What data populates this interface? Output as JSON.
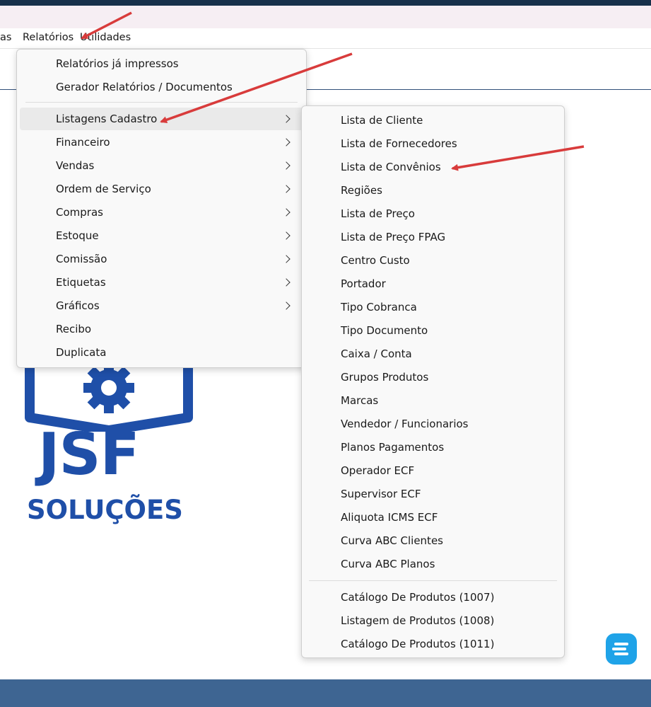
{
  "menubar": {
    "items": [
      {
        "label": "as"
      },
      {
        "label": "Relatórios"
      },
      {
        "label": "Utilidades"
      }
    ]
  },
  "relatorios_menu": {
    "top_items": [
      {
        "label": "Relatórios já impressos"
      },
      {
        "label": "Gerador Relatórios / Documentos"
      }
    ],
    "items": [
      {
        "label": "Listagens Cadastro",
        "submenu": true,
        "highlighted": true
      },
      {
        "label": "Financeiro",
        "submenu": true
      },
      {
        "label": "Vendas",
        "submenu": true
      },
      {
        "label": "Ordem de Serviço",
        "submenu": true
      },
      {
        "label": "Compras",
        "submenu": true
      },
      {
        "label": "Estoque",
        "submenu": true
      },
      {
        "label": "Comissão",
        "submenu": true
      },
      {
        "label": "Etiquetas",
        "submenu": true
      },
      {
        "label": "Gráficos",
        "submenu": true
      },
      {
        "label": "Recibo",
        "submenu": false
      },
      {
        "label": "Duplicata",
        "submenu": false
      }
    ]
  },
  "listagens_submenu": {
    "items": [
      {
        "label": "Lista de Cliente"
      },
      {
        "label": "Lista de Fornecedores"
      },
      {
        "label": "Lista de Convênios"
      },
      {
        "label": "Regiões"
      },
      {
        "label": "Lista de Preço"
      },
      {
        "label": "Lista de Preço FPAG"
      },
      {
        "label": "Centro Custo"
      },
      {
        "label": "Portador"
      },
      {
        "label": "Tipo Cobranca"
      },
      {
        "label": "Tipo Documento"
      },
      {
        "label": "Caixa / Conta"
      },
      {
        "label": "Grupos Produtos"
      },
      {
        "label": "Marcas"
      },
      {
        "label": "Vendedor / Funcionarios"
      },
      {
        "label": "Planos Pagamentos"
      },
      {
        "label": "Operador ECF"
      },
      {
        "label": "Supervisor ECF"
      },
      {
        "label": "Aliquota ICMS ECF"
      },
      {
        "label": "Curva ABC Clientes"
      },
      {
        "label": "Curva ABC Planos"
      }
    ],
    "catalog_items": [
      {
        "label": "Catálogo De Produtos (1007)"
      },
      {
        "label": "Listagem de Produtos (1008)"
      },
      {
        "label": "Catálogo De Produtos (1011)"
      }
    ]
  },
  "logo": {
    "name": "JSF",
    "subtitle": "SOLUÇÕES"
  },
  "colors": {
    "brand": "#1f4fa8",
    "annotation_arrow": "#d83b3b",
    "titlebar": "#17304a",
    "bottombar": "#3e6592",
    "chat_icon": "#1fa3e8"
  },
  "icons": {
    "submenu": "chevron-right-icon",
    "chat": "chat-widget-icon",
    "logo": "gear-book-icon"
  }
}
